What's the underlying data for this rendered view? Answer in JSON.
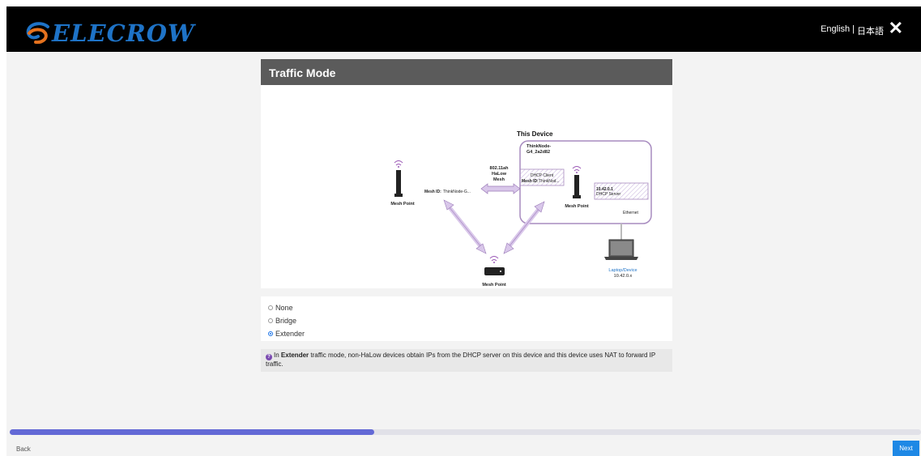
{
  "app": {
    "brand": "ELECROW"
  },
  "header": {
    "lang_en": "English",
    "lang_sep": "|",
    "lang_ja": "日本語",
    "close": "✕"
  },
  "card": {
    "title": "Traffic Mode"
  },
  "diagram": {
    "this_device": "This Device",
    "node_name_1": "ThinkNode-",
    "node_name_2": "G4_2a2d82",
    "halow_1": "802.11ah",
    "halow_2": "HaLow",
    "halow_3": "Mesh",
    "dhcp_client": "DHCP Client",
    "mesh_id_inner_label": "Mesh ID:",
    "mesh_id_inner_value": "ThinkNod...",
    "ip_addr": "10.42.0.1",
    "dhcp_server": "DHCP Server",
    "ethernet": "Ethernet",
    "mesh_id_left_label": "Mesh ID:",
    "mesh_id_left_value": "ThinkNode-G...",
    "mesh_point": "Mesh Point",
    "laptop": "Laptop/Device",
    "laptop_ip": "10.42.0.x"
  },
  "options": [
    {
      "label": "None",
      "checked": false
    },
    {
      "label": "Bridge",
      "checked": false
    },
    {
      "label": "Extender",
      "checked": true
    }
  ],
  "info": {
    "icon": "?",
    "prefix": "In ",
    "mode": "Extender",
    "text": " traffic mode, non-HaLow devices obtain IPs from the DHCP server on this device and this device uses NAT to forward IP traffic."
  },
  "progress": {
    "fraction": 0.4
  },
  "footer": {
    "back_label": "Back",
    "next_label": "Next"
  },
  "colors": {
    "accent": "#6369d6",
    "brand": "#1e73c7",
    "next": "#1e88e5",
    "diagram_purple": "#a78bbf"
  }
}
